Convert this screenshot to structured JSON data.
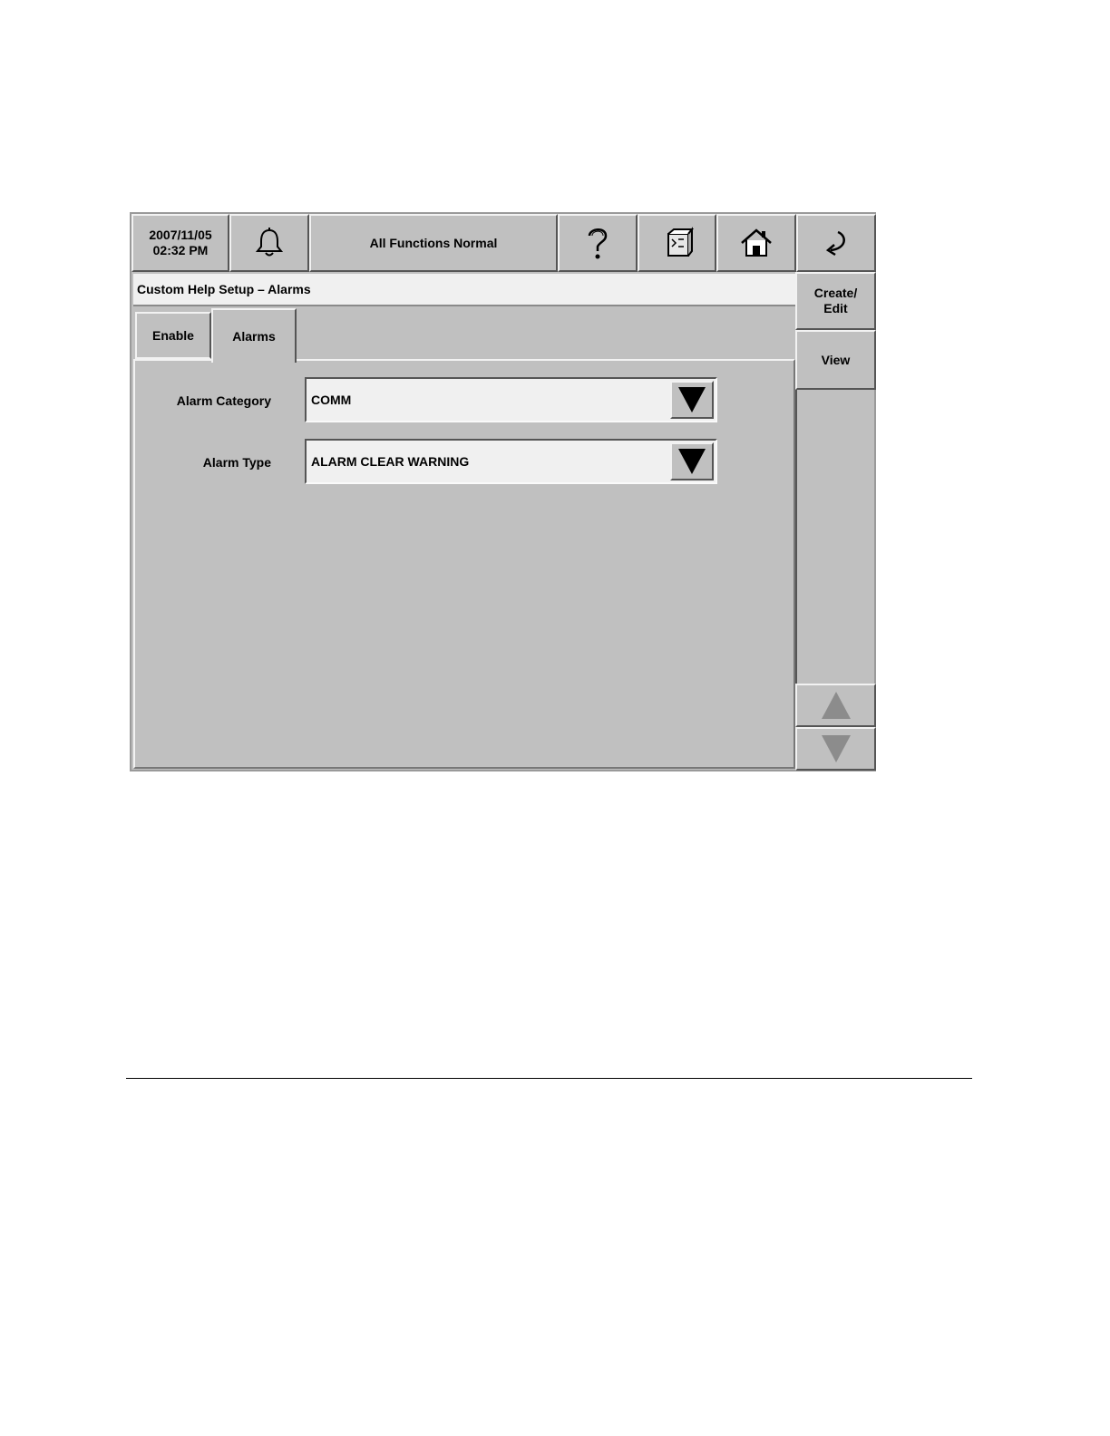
{
  "status_bar": {
    "date": "2007/11/05",
    "time": "02:32 PM",
    "status_text": "All Functions Normal",
    "icons": {
      "alarm": "bell-icon",
      "help": "question-mark-icon",
      "system": "system-map-icon",
      "home": "home-icon",
      "back": "back-arrow-icon"
    }
  },
  "screen_title": "Custom Help Setup – Alarms",
  "tabs": [
    {
      "label": "Enable",
      "active": false
    },
    {
      "label": "Alarms",
      "active": true
    }
  ],
  "form": {
    "alarm_category": {
      "label": "Alarm Category",
      "value": "COMM"
    },
    "alarm_type": {
      "label": "Alarm Type",
      "value": "ALARM CLEAR WARNING"
    }
  },
  "side_buttons": {
    "create_edit": "Create/ Edit",
    "view": "View",
    "scroll_up": "up-triangle-icon",
    "scroll_down": "down-triangle-icon"
  },
  "colors": {
    "panel_gray": "#c0c0c0",
    "field_bg": "#f0f0f0",
    "link_blue": "#0000ee"
  }
}
